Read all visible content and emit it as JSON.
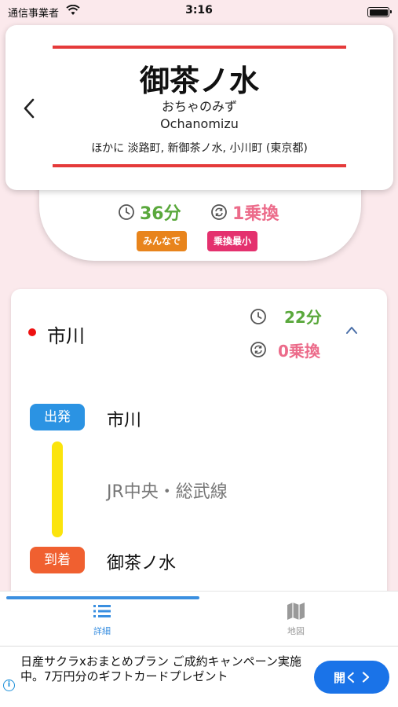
{
  "status_bar": {
    "carrier": "通信事業者",
    "time": "3:16"
  },
  "station": {
    "name": "御茶ノ水",
    "kana": "おちゃのみず",
    "romaji": "Ochanomizu",
    "other_names": "ほかに  淡路町,  新御茶ノ水,  小川町 (東京都)"
  },
  "summary": {
    "time": "36分",
    "transfers": "1乗換",
    "badges": [
      "みんなで",
      "乗換最小"
    ]
  },
  "route": {
    "origin": "市川",
    "time": "22分",
    "transfers": "0乗換",
    "depart_label": "出発",
    "depart_station": "市川",
    "line": "JR中央・総武線",
    "line_color": "#fbe40c",
    "arrive_label": "到着",
    "arrive_station": "御茶ノ水"
  },
  "tabs": [
    {
      "label": "詳細",
      "icon": "list-icon",
      "active": true
    },
    {
      "label": "地図",
      "icon": "map-icon",
      "active": false
    }
  ],
  "ad": {
    "text": "日産サクラxおまとめプラン ご成約キャンペーン実施中。7万円分のギフトカードプレゼント",
    "button": "開く"
  },
  "colors": {
    "accent": "#3a8fe0",
    "green": "#5aa83c",
    "pink": "#ec6b8a",
    "red_line": "#e53a3a"
  }
}
